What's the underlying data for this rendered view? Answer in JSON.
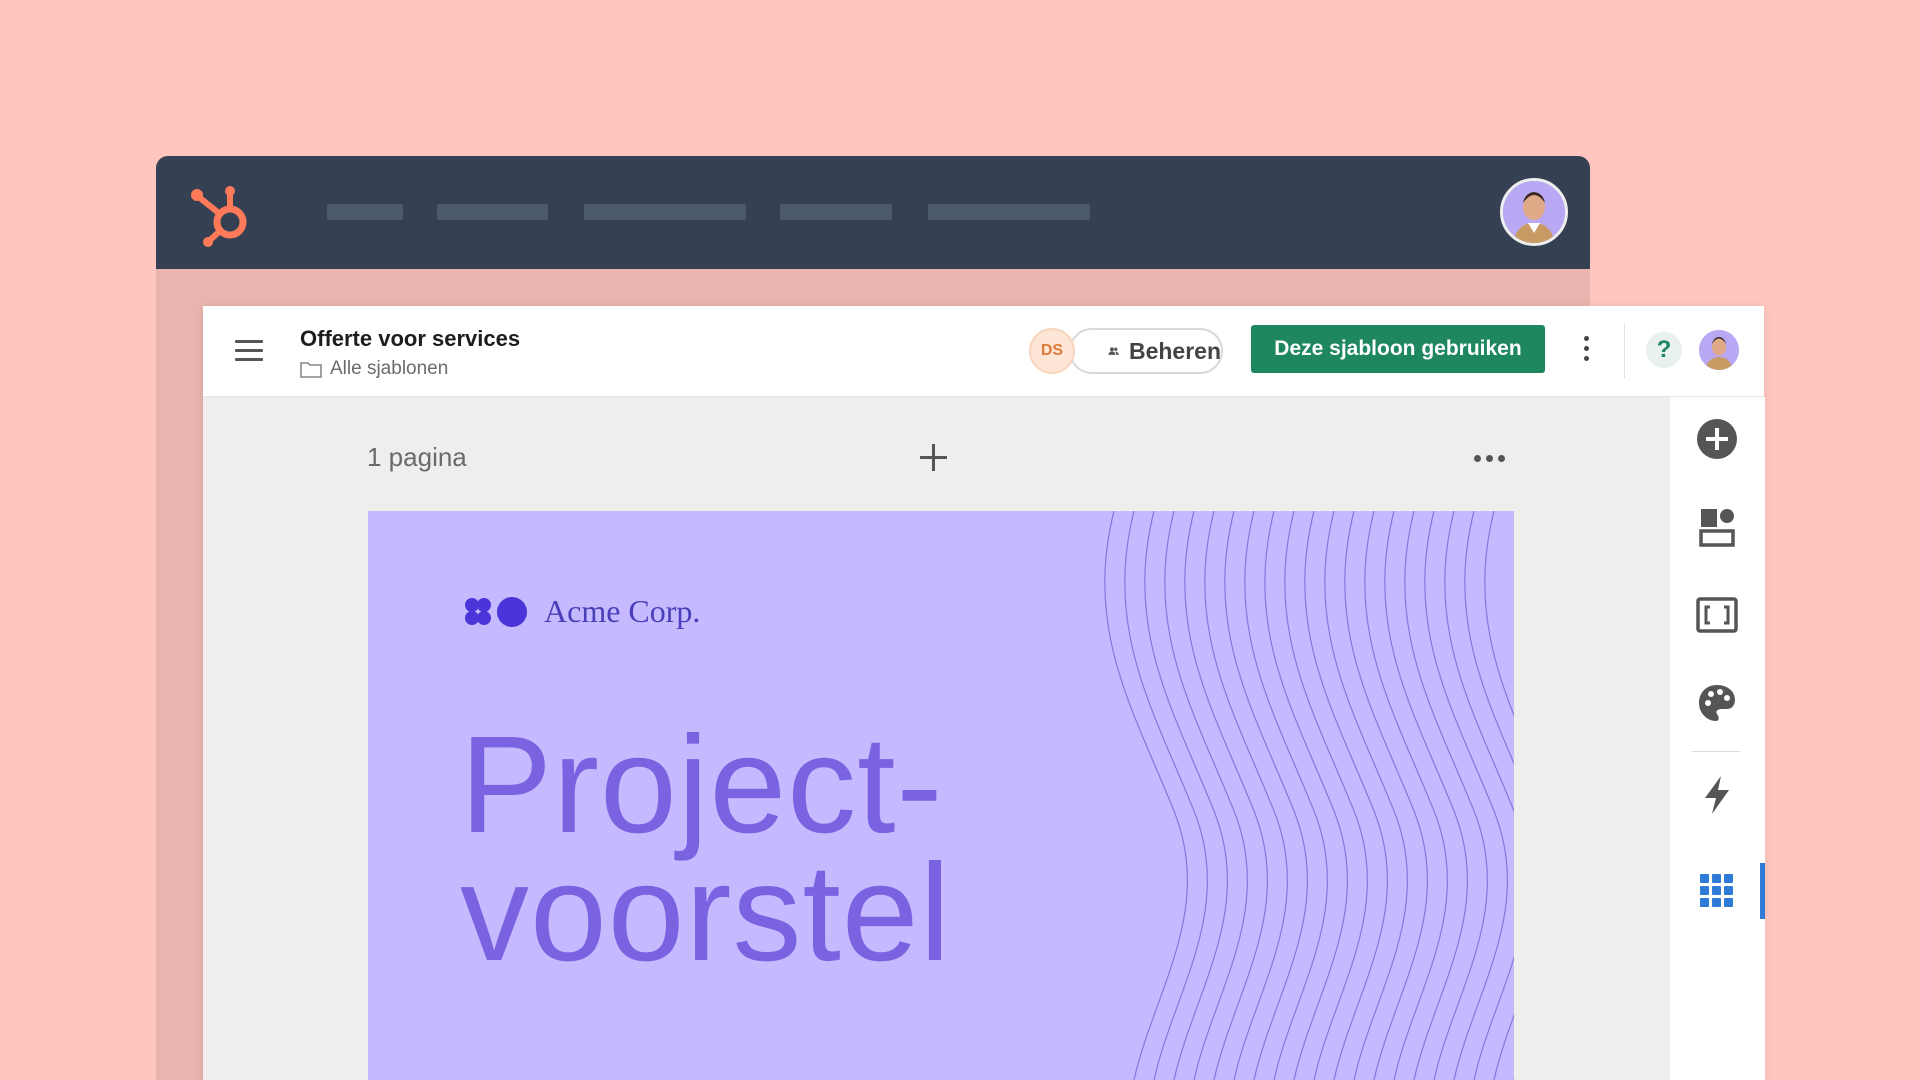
{
  "document": {
    "title": "Offerte voor services",
    "breadcrumb": "Alle sjablonen"
  },
  "collaborator": {
    "initials": "DS",
    "manage_label": "Beheren"
  },
  "actions": {
    "use_template_label": "Deze sjabloon gebruiken",
    "help_label": "?"
  },
  "canvas": {
    "page_count": "1 pagina"
  },
  "template_page": {
    "brand_name": "Acme Corp.",
    "title_line1": "Project-",
    "title_line2": "voorstel"
  },
  "colors": {
    "background": "#ffc6bf",
    "topbar": "#354052",
    "hubspot_orange": "#ff7a59",
    "primary_button": "#1e8760",
    "page_bg": "#c5baff",
    "title_purple": "#7a62e0",
    "active_accent": "#2f7bd8"
  },
  "icons": {
    "logo": "hubspot-sprocket-icon",
    "rail": [
      "add-circle-icon",
      "layout-blocks-icon",
      "brackets-frame-icon",
      "palette-icon",
      "lightning-icon",
      "grid-apps-icon"
    ]
  }
}
